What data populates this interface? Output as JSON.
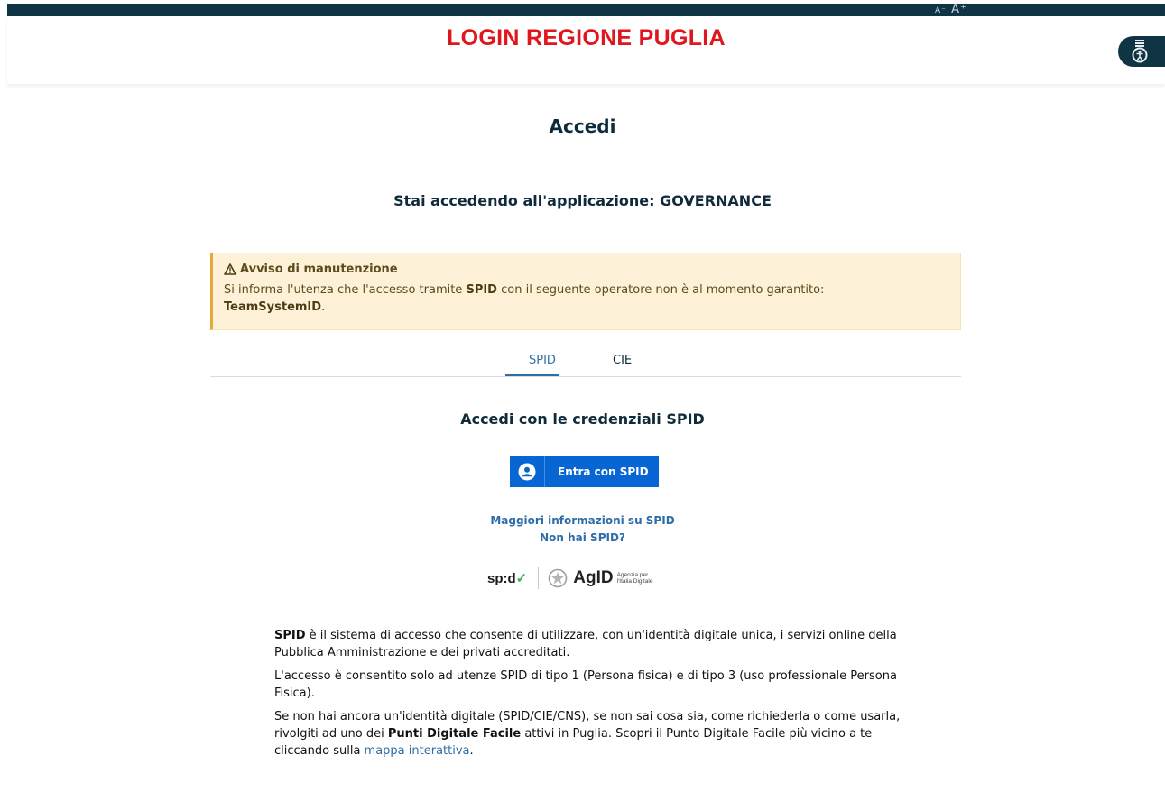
{
  "header": {
    "font_controls": {
      "decrease": "A⁻",
      "increase": "A⁺"
    },
    "brand": "LOGIN REGIONE PUGLIA",
    "accessibility_icon": "accessibility-icon"
  },
  "page": {
    "title": "Accedi",
    "subtitle": "Stai accedendo all'applicazione: GOVERNANCE"
  },
  "alert": {
    "icon": "warning-icon",
    "title": "Avviso di manutenzione",
    "body_pre": "Si informa l'utenza che l'accesso tramite ",
    "body_bold": "SPID",
    "body_mid": " con il seguente operatore non è al momento garantito: ",
    "operator": "TeamSystemID",
    "body_end": "."
  },
  "tabs": [
    {
      "label": "SPID",
      "active": true
    },
    {
      "label": "CIE",
      "active": false
    }
  ],
  "spid": {
    "section_title": "Accedi con le credenziali SPID",
    "button_label": "Entra con SPID",
    "button_icon": "user-icon",
    "more_info_link": "Maggiori informazioni su SPID",
    "no_spid_link": "Non hai SPID?",
    "logo_spid": "sp:d",
    "logo_agid": "AgID",
    "logo_agid_sub_1": "Agenzia per",
    "logo_agid_sub_2": "l'Italia Digitale"
  },
  "description": {
    "p1_bold": "SPID",
    "p1_rest": " è il sistema di accesso che consente di utilizzare, con un'identità digitale unica, i servizi online della Pubblica Amministrazione e dei privati accreditati.",
    "p2": "L'accesso è consentito solo ad utenze SPID di tipo 1 (Persona fisica) e di tipo 3 (uso professionale Persona Fisica).",
    "p3_pre": "Se non hai ancora un'identità digitale (SPID/CIE/CNS), se non sai cosa sia, come richiederla o come usarla, rivolgiti ad uno dei ",
    "p3_bold": "Punti Digitale Facile",
    "p3_mid": " attivi in Puglia. Scopri il Punto Digitale Facile più vicino a te cliccando sulla ",
    "p3_link": "mappa interattiva",
    "p3_end": "."
  },
  "colors": {
    "brand_red": "#e0161e",
    "dark_navy": "#0f3545",
    "primary_blue": "#0866d4",
    "link_blue": "#2e6ea8",
    "alert_bg": "#fdf1d8"
  }
}
